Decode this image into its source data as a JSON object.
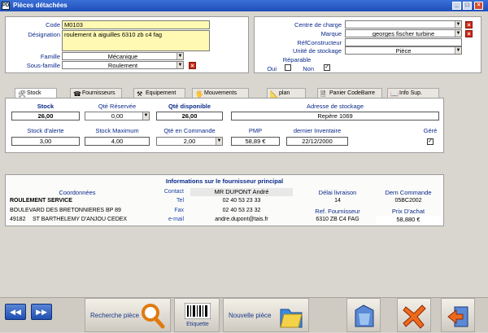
{
  "window": {
    "title": "Pièces détachées",
    "app_icon": "PD",
    "min": "_",
    "max": "□",
    "close": "×"
  },
  "header": {
    "code_label": "Code",
    "code_value": "M0103",
    "designation_label": "Désignation",
    "designation_value": "roulement à aiguilles  6310 zb c4 fag",
    "famille_label": "Famille",
    "famille_value": "Mécanique",
    "sous_famille_label": "Sous-famille",
    "sous_famille_value": "Roulement",
    "centre_charge_label": "Centre de charge",
    "centre_charge_value": "",
    "marque_label": "Marque",
    "marque_value": "georges fischer turbine",
    "ref_constructeur_label": "RéfConstructeur",
    "ref_constructeur_value": "",
    "unite_stockage_label": "Unité de stockage",
    "unite_stockage_value": "Pièce",
    "reparable_label": "Réparable",
    "oui_label": "Oui",
    "non_label": "Non"
  },
  "tabs": [
    {
      "label": "Stock",
      "icon": "🛠"
    },
    {
      "label": "Fournisseurs",
      "icon": "☎"
    },
    {
      "label": "Equipement",
      "icon": "⚒"
    },
    {
      "label": "Mouvements",
      "icon": "🖐"
    },
    {
      "label": "plan",
      "icon": "📐"
    },
    {
      "label": "Panier CodeBarre",
      "icon": "🗎"
    },
    {
      "label": "Info Sup.",
      "icon": "📖"
    }
  ],
  "stock": {
    "stock_label": "Stock",
    "stock_value": "26,00",
    "qte_reservee_label": "Qté Réservée",
    "qte_reservee_value": "0,00",
    "qte_disponible_label": "Qté disponible",
    "qte_disponible_value": "26,00",
    "adresse_label": "Adresse de stockage",
    "adresse_value": "Repère 1069",
    "stock_alerte_label": "Stock d'alerte",
    "stock_alerte_value": "3,00",
    "stock_max_label": "Stock Maximum",
    "stock_max_value": "4,00",
    "qte_commande_label": "Qté en Commande",
    "qte_commande_value": "2,00",
    "pmp_label": "PMP",
    "pmp_value": "58,89 €",
    "dernier_inventaire_label": "dernier Inventaire",
    "dernier_inventaire_value": "22/12/2000",
    "gere_label": "Géré"
  },
  "fournisseur": {
    "section_title": "Informations sur le fournisseur principal",
    "coordonnees_label": "Coordonnées",
    "name": "ROULEMENT SERVICE",
    "address1": "BOULEVARD DES BRETONNIERES   BP 89",
    "zip": "49182",
    "city": "ST BARTHELEMY D'ANJOU  CEDEX",
    "contact_label": "Contact",
    "contact_value": "MR DUPONT André",
    "tel_label": "Tel",
    "tel_value": "02 40 53 23 33",
    "fax_label": "Fax",
    "fax_value": "02 40 53 23 32",
    "email_label": "e-mail",
    "email_value": "andre.dupont@tais.fr",
    "delai_label": "Délai livraison",
    "delai_value": "14",
    "ref_fournisseur_label": "Ref. Fournisseur",
    "ref_fournisseur_value": "6310 ZB C4 FAG",
    "dern_commande_label": "Dern Commande",
    "dern_commande_value": "05BC2002",
    "prix_achat_label": "Prix D'achat",
    "prix_achat_value": "58,880 €"
  },
  "toolbar": {
    "prev": "◀◀",
    "next": "▶▶",
    "recherche_label": "Recherche pièce",
    "etiquette_label": "Etiquette",
    "nouvelle_label": "Nouvelle pièce"
  },
  "colors": {
    "accent": "#0a2a8a",
    "title_bar": "#2a5fc8",
    "close": "#d12a1a"
  }
}
